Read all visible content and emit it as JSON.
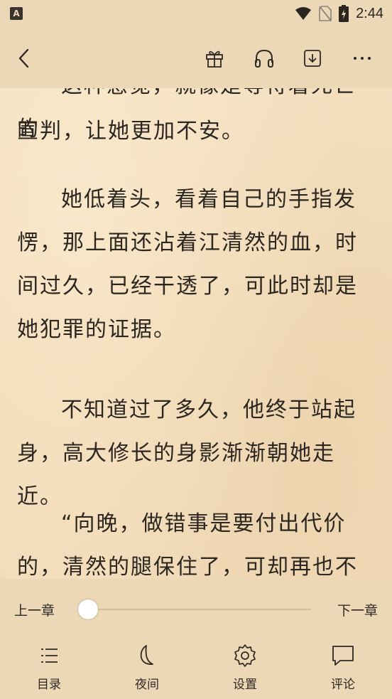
{
  "status_bar": {
    "notification_glyph": "A",
    "time": "2:44",
    "icons": [
      "wifi-icon",
      "no-sim-icon",
      "battery-charging-icon"
    ]
  },
  "top_bar": {
    "icons": [
      "back-icon",
      "gift-icon",
      "headphones-icon",
      "download-icon",
      "more-icon"
    ]
  },
  "reader": {
    "partial_top_line": "这种感觉，就像是等待着死亡的",
    "paragraphs": [
      "宣判，让她更加不安。",
      "她低着头，看着自己的手指发愣，那上面还沾着江清然的血，时间过久，已经干透了，可此时却是她犯罪的证据。",
      "不知道过了多久，他终于站起身，高大修长的身影渐渐朝她走近。",
      "“向晚，做错事是要付出代价的，清然的腿保住了，可却再也不能跳舞"
    ]
  },
  "chapter_nav": {
    "prev_label": "上一章",
    "next_label": "下一章",
    "progress": 0.0
  },
  "bottom_nav": {
    "items": [
      {
        "label": "目录",
        "icon": "catalog-icon"
      },
      {
        "label": "夜间",
        "icon": "moon-icon"
      },
      {
        "label": "设置",
        "icon": "gear-icon"
      },
      {
        "label": "评论",
        "icon": "comment-icon"
      }
    ]
  },
  "colors": {
    "background": "#f3dfbf",
    "bar": "#ecd7b6",
    "text": "#2b2620"
  }
}
